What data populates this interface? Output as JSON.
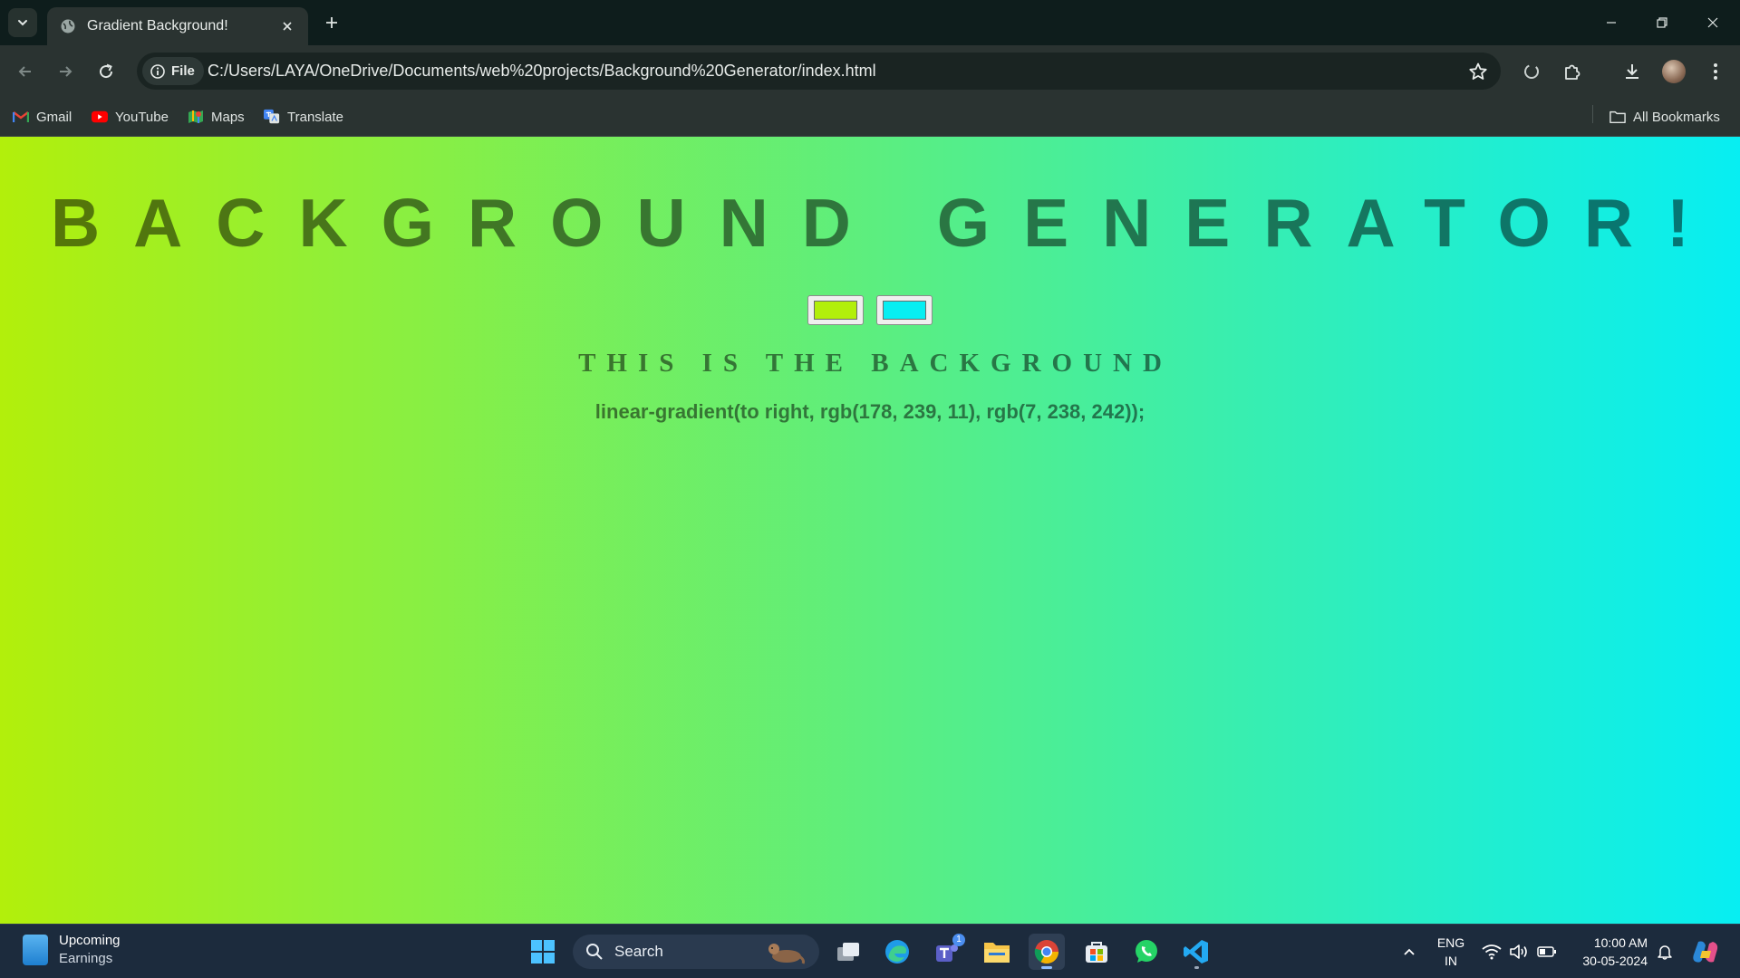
{
  "browser": {
    "tab": {
      "title": "Gradient Background!"
    },
    "address": {
      "chip_label": "File",
      "url": "C:/Users/LAYA/OneDrive/Documents/web%20projects/Background%20Generator/index.html"
    },
    "bookmarks": [
      {
        "label": "Gmail",
        "icon": "gmail-icon"
      },
      {
        "label": "YouTube",
        "icon": "youtube-icon"
      },
      {
        "label": "Maps",
        "icon": "maps-icon"
      },
      {
        "label": "Translate",
        "icon": "translate-icon"
      }
    ],
    "all_bookmarks_label": "All Bookmarks"
  },
  "page": {
    "heading": "BACKGROUND GENERATOR!",
    "color1": "#b2ef0b",
    "color2": "#07eef2",
    "subheading": "THIS IS THE BACKGROUND",
    "css_output": "linear-gradient(to right, rgb(178, 239, 11), rgb(7, 238, 242));"
  },
  "taskbar": {
    "widget": {
      "title": "Upcoming",
      "subtitle": "Earnings"
    },
    "search_label": "Search",
    "teams_badge": "1",
    "language": {
      "line1": "ENG",
      "line2": "IN"
    },
    "clock": {
      "time": "10:00 AM",
      "date": "30-05-2024"
    }
  },
  "colors": {
    "gradient_start": "#b2ef0b",
    "gradient_end": "#07eef2"
  }
}
